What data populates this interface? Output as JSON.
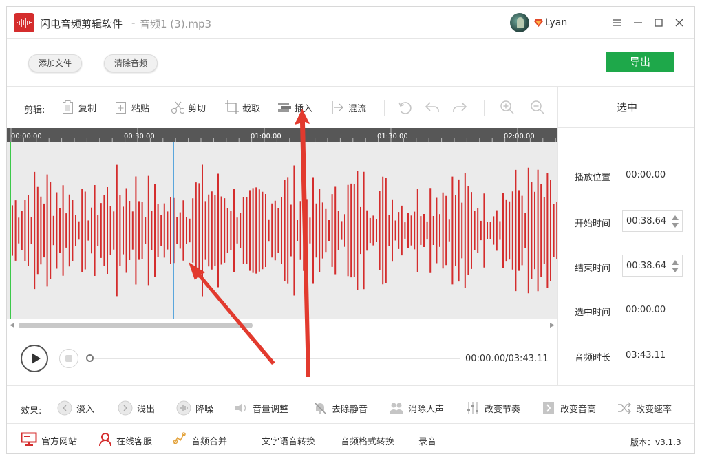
{
  "title": {
    "app_name": "闪电音频剪辑软件",
    "separator": "-",
    "file_name": "音频1 (3).mp3",
    "user_name": "Lyan"
  },
  "actions": {
    "add_file": "添加文件",
    "clear_audio": "清除音频",
    "export": "导出"
  },
  "edit_toolbar": {
    "label": "剪辑:",
    "items": [
      "复制",
      "粘贴",
      "剪切",
      "截取",
      "插入",
      "混流"
    ]
  },
  "timeline": {
    "ticks": [
      "00:00.00",
      "00:30.00",
      "01:00.00",
      "01:30.00",
      "02:00.00"
    ]
  },
  "selection_panel": {
    "header": "选中",
    "play_position_label": "播放位置",
    "play_position": "00:00.00",
    "start_label": "开始时间",
    "start_value": "00:38.64",
    "end_label": "结束时间",
    "end_value": "00:38.64",
    "selected_label": "选中时间",
    "selected_value": "00:00.00",
    "duration_label": "音频时长",
    "duration_value": "03:43.11"
  },
  "player": {
    "time": "00:00.00/03:43.11",
    "progress_fraction": 0
  },
  "effects": {
    "label": "效果:",
    "items": [
      "淡入",
      "浅出",
      "降噪",
      "音量调整",
      "去除静音",
      "消除人声",
      "改变节奏",
      "改变音高",
      "改变速率"
    ]
  },
  "footer": {
    "items": [
      "官方网站",
      "在线客服",
      "音频合并",
      "文字语音转换",
      "音频格式转换",
      "录音"
    ],
    "version": "版本：v3.1.3"
  },
  "colors": {
    "accent_green": "#1ea84a",
    "waveform_red": "#d42d2d",
    "cursor_blue": "#2a8fd8",
    "start_marker_green": "#3cc84a"
  }
}
